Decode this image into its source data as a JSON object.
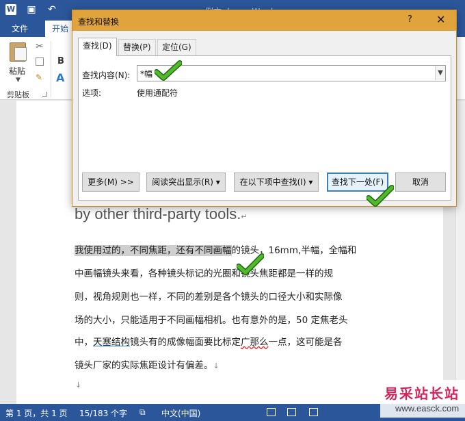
{
  "word": {
    "app_icon": "W",
    "doc_title": "例文.docx - Word",
    "tabs": {
      "file": "文件",
      "home": "开始"
    },
    "ribbon": {
      "paste_label": "粘贴",
      "clipboard_group": "剪贴板",
      "bold": "B",
      "text_effects": "A"
    }
  },
  "document": {
    "english_line": "by other third-party tools.",
    "lines": [
      [
        "我使用过的，不同焦距，还有不同画",
        "幅",
        "的镜头，16mm,半幅，全幅和"
      ],
      [
        "中画幅镜头来看，各种镜头标记的光圈和镜头焦距都是一样的规"
      ],
      [
        "则，视角规则也一样，不同的差别是各个镜头的口径大小和实际像"
      ],
      [
        "场的大小，只能适用于不同画幅相机。也有意外的是，50 定焦老头"
      ],
      [
        "中，",
        "天塞结构",
        "镜头有的成像幅面要比标定",
        "广那么",
        "一点，这可能是各"
      ],
      [
        "镜头厂家的实际焦距设计有偏差。"
      ]
    ],
    "para_mark": "↵",
    "line_end": "↓"
  },
  "status": {
    "page": "第 1 页，共 1 页",
    "words": "15/183 个字",
    "language": "中文(中国)"
  },
  "watermark": {
    "text": "易采站长站",
    "url": "www.easck.com"
  },
  "dialog": {
    "title": "查找和替换",
    "help": "?",
    "close": "✕",
    "tabs": [
      "查找(D)",
      "替换(P)",
      "定位(G)"
    ],
    "find_label": "查找内容(N):",
    "find_value": "*幅",
    "options_label": "选项:",
    "options_value": "使用通配符",
    "buttons": {
      "more": "更多(M) >>",
      "reading_highlight": "阅读突出显示(R) ▾",
      "find_in": "在以下项中查找(I) ▾",
      "find_next": "查找下一处(F)",
      "cancel": "取消"
    }
  },
  "colors": {
    "word_blue": "#2b579a",
    "dialog_title": "#e1a33c",
    "check_green": "#52b82e"
  }
}
